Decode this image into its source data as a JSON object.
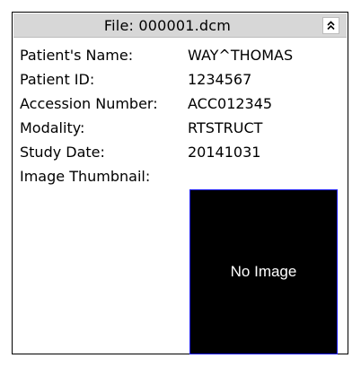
{
  "header": {
    "title": "File: 000001.dcm",
    "collapse_icon": "double-chevron-up-icon"
  },
  "fields": [
    {
      "label": "Patient's Name:",
      "value": "WAY^THOMAS"
    },
    {
      "label": "Patient ID:",
      "value": "1234567"
    },
    {
      "label": "Accession Number:",
      "value": "ACC012345"
    },
    {
      "label": "Modality:",
      "value": "RTSTRUCT"
    },
    {
      "label": "Study Date:",
      "value": "20141031"
    }
  ],
  "thumbnail": {
    "label": "Image Thumbnail:",
    "placeholder_text": "No Image"
  },
  "colors": {
    "title_bar": "#d7d7d7",
    "thumbnail_bg": "#000000",
    "thumbnail_border": "#1c1cff"
  }
}
